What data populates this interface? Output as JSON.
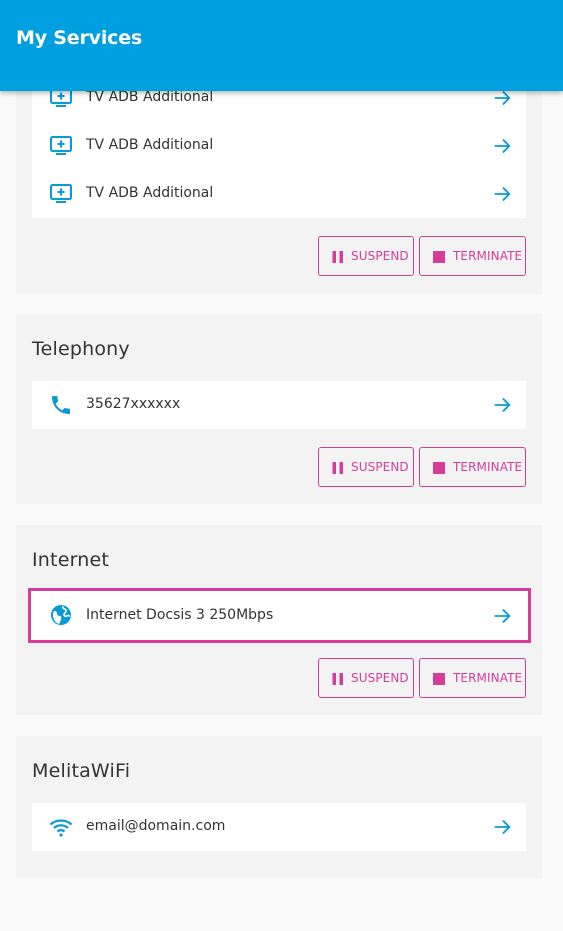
{
  "app_bar": {
    "title": "My Services"
  },
  "colors": {
    "primary": "#009fe0",
    "accent": "#d63d9b",
    "card_bg": "#f3f3f3"
  },
  "tv": {
    "items": [
      {
        "label": "TV ADB Additional",
        "icon": "tv-add-icon"
      },
      {
        "label": "TV ADB Additional",
        "icon": "tv-add-icon"
      },
      {
        "label": "TV ADB Additional",
        "icon": "tv-add-icon"
      }
    ],
    "suspend_label": "SUSPEND",
    "terminate_label": "TERMINATE"
  },
  "telephony": {
    "title": "Telephony",
    "items": [
      {
        "label": "35627xxxxxx",
        "icon": "phone-icon"
      }
    ],
    "suspend_label": "SUSPEND",
    "terminate_label": "TERMINATE"
  },
  "internet": {
    "title": "Internet",
    "items": [
      {
        "label": "Internet Docsis 3 250Mbps",
        "icon": "globe-icon"
      }
    ],
    "suspend_label": "SUSPEND",
    "terminate_label": "TERMINATE"
  },
  "wifi": {
    "title": "MelitaWiFi",
    "items": [
      {
        "label": "email@domain.com",
        "icon": "wifi-icon"
      }
    ]
  }
}
